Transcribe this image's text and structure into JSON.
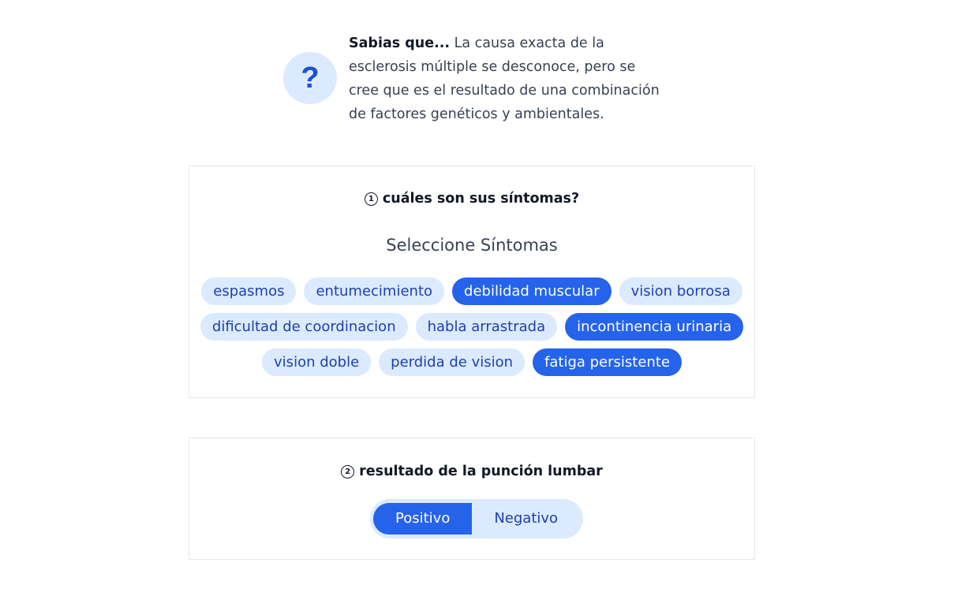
{
  "fact": {
    "icon": "question-mark-icon",
    "icon_glyph": "?",
    "heading": "Sabias que...",
    "body": "La causa exacta de la esclerosis múltiple se desconoce, pero se cree que es el resultado de una combinación de factores genéticos y ambientales."
  },
  "step1": {
    "number": "1",
    "question": "cuáles son sus síntomas?",
    "select_label": "Seleccione Síntomas",
    "symptoms": [
      {
        "label": "espasmos",
        "selected": false
      },
      {
        "label": "entumecimiento",
        "selected": false
      },
      {
        "label": "debilidad muscular",
        "selected": true
      },
      {
        "label": "vision borrosa",
        "selected": false
      },
      {
        "label": "dificultad de coordinacion",
        "selected": false
      },
      {
        "label": "habla arrastrada",
        "selected": false
      },
      {
        "label": "incontinencia urinaria",
        "selected": true
      },
      {
        "label": "vision doble",
        "selected": false
      },
      {
        "label": "perdida de vision",
        "selected": false
      },
      {
        "label": "fatiga persistente",
        "selected": true
      }
    ]
  },
  "step2": {
    "number": "2",
    "question": "resultado de la punción lumbar",
    "options": [
      {
        "label": "Positivo",
        "selected": true
      },
      {
        "label": "Negativo",
        "selected": false
      }
    ]
  },
  "colors": {
    "accent": "#2563eb",
    "chip_bg": "#dbeafe",
    "chip_text": "#1e40af"
  }
}
